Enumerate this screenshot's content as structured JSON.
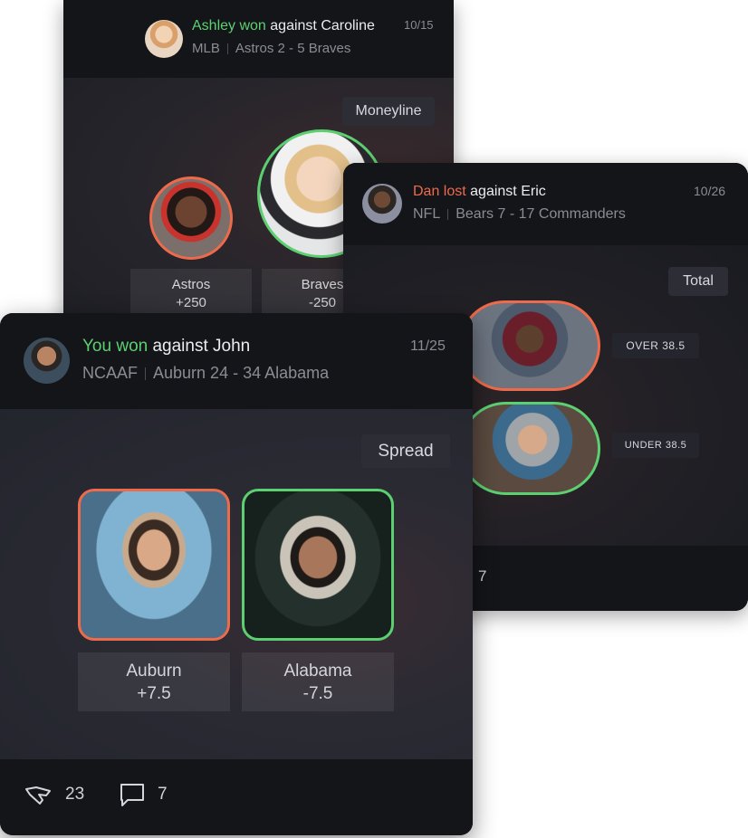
{
  "cards": {
    "ashley": {
      "winner": "Ashley won",
      "rest": " against Caroline",
      "league": "MLB",
      "score": "Astros 2 - 5 Braves",
      "date": "10/15",
      "bet_type": "Moneyline",
      "picks": [
        {
          "team": "Astros",
          "line": "+250",
          "result": "lost"
        },
        {
          "team": "Braves",
          "line": "-250",
          "result": "won"
        }
      ]
    },
    "dan": {
      "loser": "Dan lost",
      "rest": " against Eric",
      "league": "NFL",
      "score": "Bears 7 - 17 Commanders",
      "date": "10/26",
      "bet_type": "Total",
      "picks": [
        {
          "label": "OVER 38.5",
          "result": "lost"
        },
        {
          "label": "UNDER 38.5",
          "result": "won"
        }
      ],
      "comments": "7"
    },
    "you": {
      "winner": "You won",
      "rest": " against John",
      "league": "NCAAF",
      "score": "Auburn 24 - 34 Alabama",
      "date": "11/25",
      "bet_type": "Spread",
      "picks": [
        {
          "team": "Auburn",
          "line": "+7.5",
          "result": "lost"
        },
        {
          "team": "Alabama",
          "line": "-7.5",
          "result": "won"
        }
      ],
      "likes": "23",
      "comments": "7"
    }
  },
  "colors": {
    "won": "#5cd071",
    "lost": "#ef6a4a",
    "card_bg": "#16171c"
  },
  "icons": {
    "like": "handshake-icon",
    "comment": "comment-bubble-icon"
  }
}
